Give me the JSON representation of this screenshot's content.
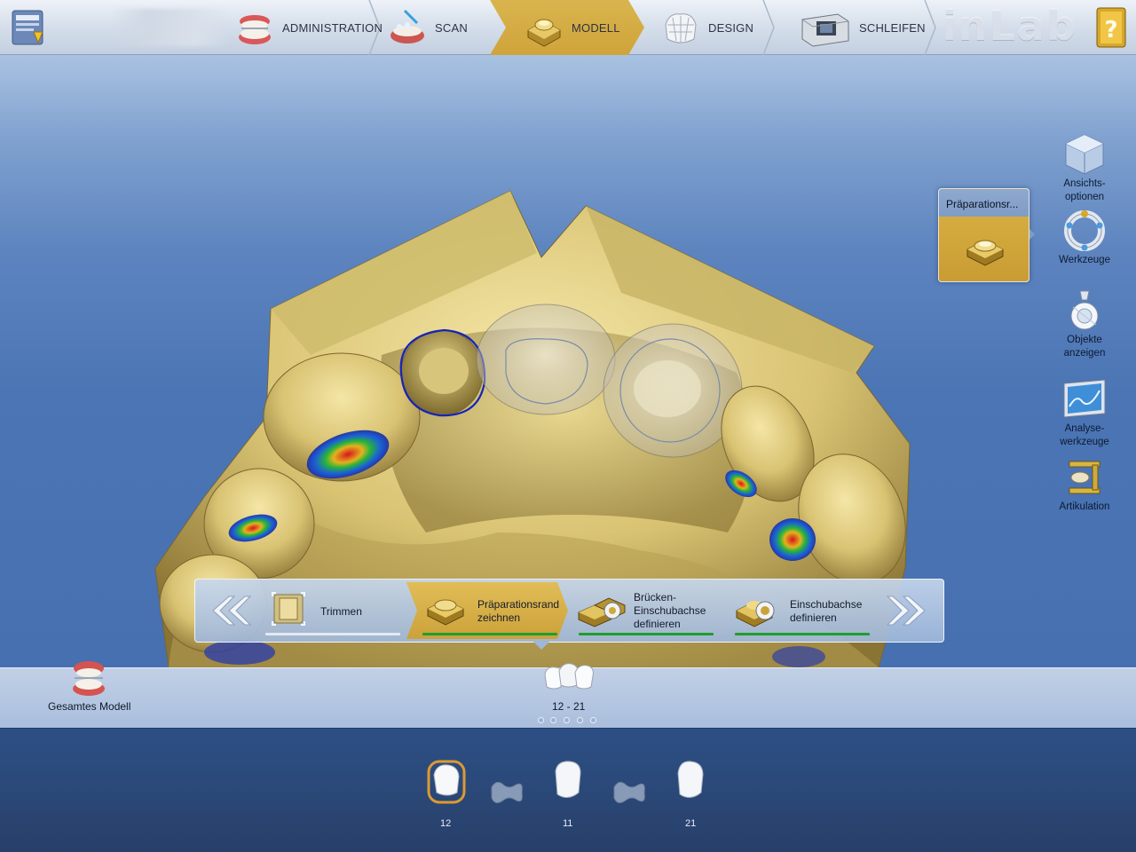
{
  "topbar": {
    "steps": [
      {
        "label": "ADMINISTRATION",
        "icon": "dental-model-icon"
      },
      {
        "label": "SCAN",
        "icon": "scan-jaw-icon"
      },
      {
        "label": "MODELL",
        "icon": "model-die-icon",
        "active": true
      },
      {
        "label": "DESIGN",
        "icon": "crown-lattice-icon"
      },
      {
        "label": "SCHLEIFEN",
        "icon": "milling-unit-icon"
      }
    ],
    "brand": "inLab",
    "help_icon": "help-book-icon"
  },
  "tools": [
    {
      "label": "Ansichts-\noptionen",
      "icon": "view-cube-icon"
    },
    {
      "label": "Werkzeuge",
      "icon": "tool-ring-icon"
    },
    {
      "label": "Objekte\nanzeigen",
      "icon": "objects-lamp-icon"
    },
    {
      "label": "Analyse-\nwerkzeuge",
      "icon": "analysis-screen-icon"
    },
    {
      "label": "Artikulation",
      "icon": "articulator-icon"
    }
  ],
  "popup": {
    "title": "Präparationsr...",
    "icon": "preparation-die-icon"
  },
  "substeps": {
    "prev_icon": "double-chevron-left-icon",
    "next_icon": "double-chevron-right-icon",
    "items": [
      {
        "label": "Trimmen",
        "icon": "trim-icon",
        "progress_color": "#dfe6f0"
      },
      {
        "label": "Präparationsrand\nzeichnen",
        "icon": "preparation-margin-icon",
        "progress_color": "#1f9e2e",
        "active": true
      },
      {
        "label": "Brücken-\nEinschubachse\ndefinieren",
        "icon": "bridge-axis-icon",
        "progress_color": "#1f9e2e"
      },
      {
        "label": "Einschubachse\ndefinieren",
        "icon": "insertion-axis-icon",
        "progress_color": "#1f9e2e"
      }
    ]
  },
  "modelstrip": {
    "whole_model_label": "Gesamtes Modell",
    "bridge_label": "12 - 21",
    "page_dots": 5
  },
  "teeth": [
    {
      "number": "12",
      "selected": true
    },
    {
      "number": "11",
      "selected": false
    },
    {
      "number": "21",
      "selected": false
    }
  ],
  "colors": {
    "active_step": "#d4ab45",
    "progress_done": "#1f9e2e",
    "viewport_bg": "#4b75b4",
    "model_gold": "#d9c67a"
  }
}
